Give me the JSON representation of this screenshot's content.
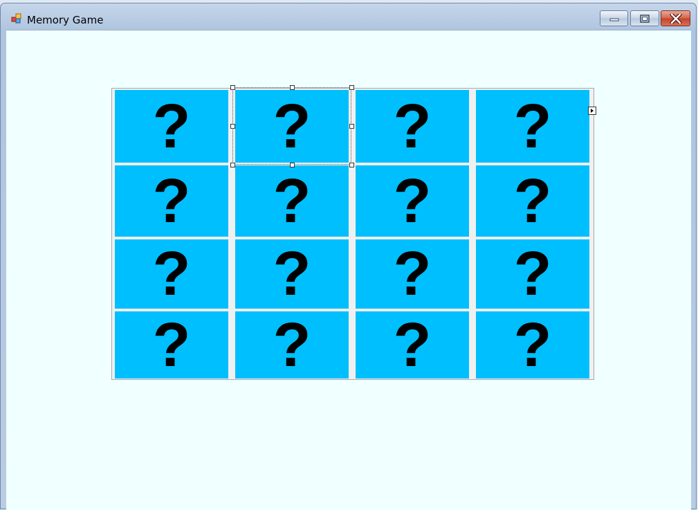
{
  "window": {
    "title": "Memory Game",
    "app_icon": "windows-forms-app-icon",
    "controls": {
      "minimize_icon": "minimize-icon",
      "maximize_icon": "maximize-icon",
      "close_icon": "close-icon"
    }
  },
  "board": {
    "rows": 4,
    "columns": 4,
    "card_color": "#00bfff",
    "background_color": "#f0ffff",
    "cards": [
      [
        "?",
        "?",
        "?",
        "?"
      ],
      [
        "?",
        "?",
        "?",
        "?"
      ],
      [
        "?",
        "?",
        "?",
        "?"
      ],
      [
        "?",
        "?",
        "?",
        "?"
      ]
    ],
    "selected_card": {
      "row": 0,
      "column": 1
    },
    "smart_tag_icon": "smart-tag-arrow-icon"
  }
}
